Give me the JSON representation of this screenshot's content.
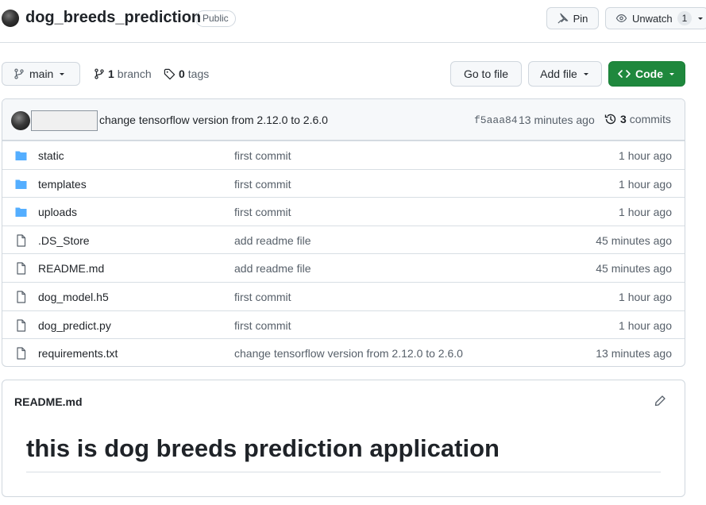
{
  "repo": {
    "name": "dog_breeds_prediction",
    "visibility": "Public"
  },
  "header_actions": {
    "pin_label": "Pin",
    "watch_label": "Unwatch",
    "watch_count": "1"
  },
  "toolbar": {
    "branch_selector": "main",
    "branch_count": "1",
    "branch_label": "branch",
    "tag_count": "0",
    "tag_label": "tags",
    "go_to_file": "Go to file",
    "add_file": "Add file",
    "code": "Code"
  },
  "latest_commit": {
    "message": "change tensorflow version from 2.12.0 to 2.6.0",
    "sha": "f5aaa84",
    "time": "13 minutes ago",
    "commit_count": "3",
    "commit_label": "commits"
  },
  "files": [
    {
      "name": "static",
      "type": "folder",
      "message": "first commit",
      "time": "1 hour ago"
    },
    {
      "name": "templates",
      "type": "folder",
      "message": "first commit",
      "time": "1 hour ago"
    },
    {
      "name": "uploads",
      "type": "folder",
      "message": "first commit",
      "time": "1 hour ago"
    },
    {
      "name": ".DS_Store",
      "type": "file",
      "message": "add readme file",
      "time": "45 minutes ago"
    },
    {
      "name": "README.md",
      "type": "file",
      "message": "add readme file",
      "time": "45 minutes ago"
    },
    {
      "name": "dog_model.h5",
      "type": "file",
      "message": "first commit",
      "time": "1 hour ago"
    },
    {
      "name": "dog_predict.py",
      "type": "file",
      "message": "first commit",
      "time": "1 hour ago"
    },
    {
      "name": "requirements.txt",
      "type": "file",
      "message": "change tensorflow version from 2.12.0 to 2.6.0",
      "time": "13 minutes ago"
    }
  ],
  "readme": {
    "title": "README.md",
    "heading": "this is dog breeds prediction application"
  },
  "colors": {
    "accent_green": "#1f883d",
    "folder_blue": "#54aeff",
    "muted_text": "#57606a"
  }
}
